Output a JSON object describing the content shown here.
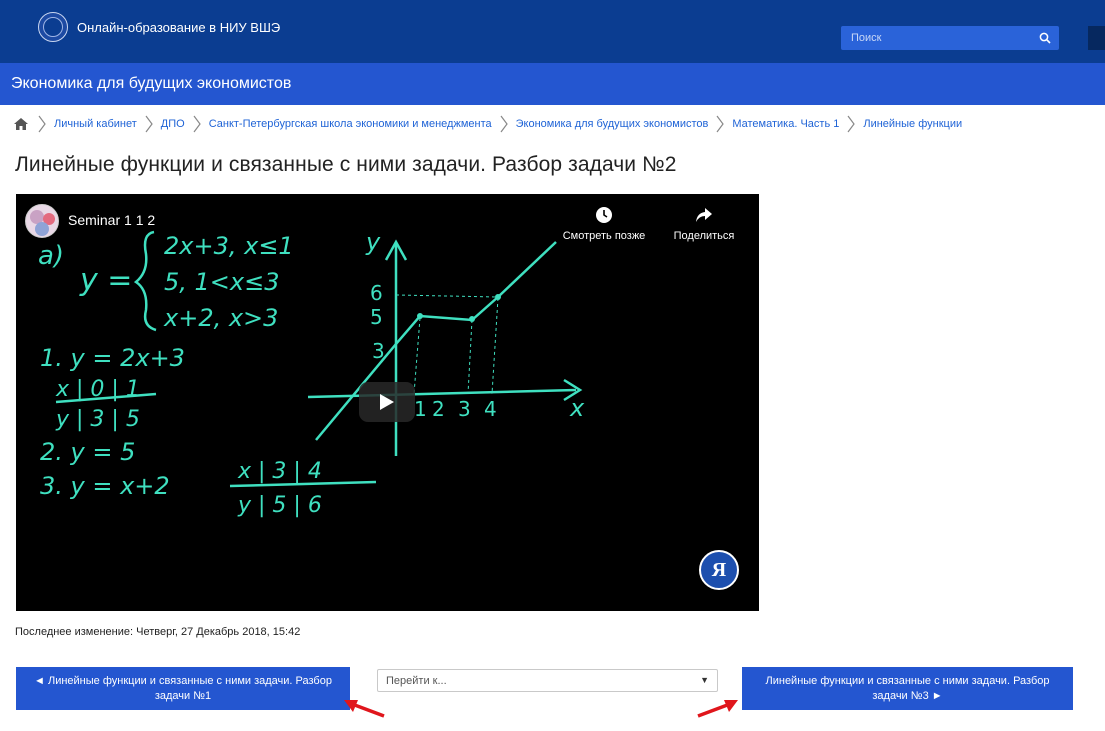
{
  "header": {
    "site_title": "Онлайн-образование в НИУ ВШЭ",
    "search_placeholder": "Поиск"
  },
  "course": {
    "title": "Экономика для будущих экономистов"
  },
  "breadcrumb": [
    "Личный кабинет",
    "ДПО",
    "Санкт-Петербургская школа экономики и менеджмента",
    "Экономика для будущих экономистов",
    "Математика. Часть 1",
    "Линейные функции"
  ],
  "page": {
    "title": "Линейные функции и связанные с ними задачи. Разбор задачи №2",
    "last_modified": "Последнее изменение: Четверг, 27 Декабрь 2018, 15:42"
  },
  "video": {
    "title": "Seminar 1 1 2",
    "watch_later": "Смотреть позже",
    "share": "Поделиться",
    "hse_badge": "Я",
    "board": {
      "label_a": "a)",
      "system_y": "y =",
      "system_1": "2x+3, x≤1",
      "system_2": "5, 1<x≤3",
      "system_3": "x+2, x>3",
      "step_1": "1. y = 2x+3",
      "table_1_x": "x | 0 | 1",
      "table_1_y": "y | 3 | 5",
      "step_2": "2. y = 5",
      "step_3": "3. y = x+2",
      "table_3_x": "x | 3 | 4",
      "table_3_y": "y | 5 | 6",
      "axis_y": "y",
      "axis_x": "x",
      "tick_6": "6",
      "tick_5": "5",
      "tick_3": "3",
      "tick_x1": "1",
      "tick_x2": "2",
      "tick_x3": "3",
      "tick_x4": "4"
    }
  },
  "navigation": {
    "prev_label": "◄ Линейные функции и связанные с ними задачи. Разбор задачи №1",
    "jump_placeholder": "Перейти к...",
    "next_label": "Линейные функции и связанные с ними задачи. Разбор задачи №3 ►"
  },
  "colors": {
    "topbar": "#0b3d91",
    "coursebar": "#2456d0",
    "link": "#1f63d6",
    "chalk": "#3fe0c0",
    "annotation_arrow": "#e0161c"
  }
}
